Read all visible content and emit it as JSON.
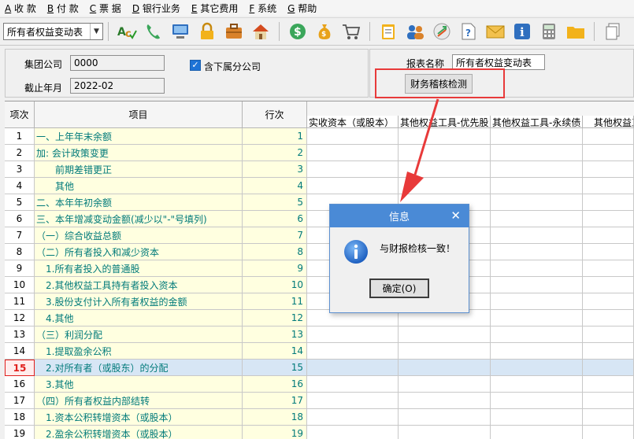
{
  "menu": [
    {
      "key": "A",
      "label": "收 款"
    },
    {
      "key": "B",
      "label": "付 款"
    },
    {
      "key": "C",
      "label": "票 据"
    },
    {
      "key": "D",
      "label": "银行业务"
    },
    {
      "key": "E",
      "label": "其它费用"
    },
    {
      "key": "F",
      "label": "系统"
    },
    {
      "key": "G",
      "label": "帮助"
    }
  ],
  "toolbar": {
    "report_select": "所有者权益变动表"
  },
  "form": {
    "group_label": "集团公司",
    "group_value": "0000",
    "include_sub_label": "含下属分公司",
    "include_sub_checked": true,
    "period_label": "截止年月",
    "period_value": "2022-02",
    "report_name_label": "报表名称",
    "report_name_value": "所有者权益变动表",
    "check_button": "财务稽核检测"
  },
  "grid": {
    "headers": {
      "no": "项次",
      "item": "项目",
      "line": "行次",
      "col1": "实收资本（或股本）",
      "col2": "其他权益工具-优先股",
      "col3": "其他权益工具-永续债",
      "col4": "其他权益工具"
    },
    "rows": [
      {
        "no": "1",
        "item": "一、上年年末余额",
        "line": "1"
      },
      {
        "no": "2",
        "item": "加: 会计政策变更",
        "line": "2"
      },
      {
        "no": "3",
        "item": "　　前期差错更正",
        "line": "3"
      },
      {
        "no": "4",
        "item": "　　其他",
        "line": "4"
      },
      {
        "no": "5",
        "item": "二、本年年初余额",
        "line": "5"
      },
      {
        "no": "6",
        "item": "三、本年增减变动金额(减少以\"-\"号填列)",
        "line": "6"
      },
      {
        "no": "7",
        "item": "（一）综合收益总额",
        "line": "7"
      },
      {
        "no": "8",
        "item": "（二）所有者投入和减少资本",
        "line": "8"
      },
      {
        "no": "9",
        "item": "　1.所有者投入的普通股",
        "line": "9"
      },
      {
        "no": "10",
        "item": "　2.其他权益工具持有者投入资本",
        "line": "10"
      },
      {
        "no": "11",
        "item": "　3.股份支付计入所有者权益的金额",
        "line": "11"
      },
      {
        "no": "12",
        "item": "　4.其他",
        "line": "12"
      },
      {
        "no": "13",
        "item": "（三）利润分配",
        "line": "13"
      },
      {
        "no": "14",
        "item": "　1.提取盈余公积",
        "line": "14"
      },
      {
        "no": "15",
        "item": "　2.对所有者（或股东）的分配",
        "line": "15"
      },
      {
        "no": "16",
        "item": "　3.其他",
        "line": "16"
      },
      {
        "no": "17",
        "item": "（四）所有者权益内部结转",
        "line": "17"
      },
      {
        "no": "18",
        "item": "　1.资本公积转增资本（或股本）",
        "line": "18"
      },
      {
        "no": "19",
        "item": "　2.盈余公积转增资本（或股本）",
        "line": "19"
      }
    ],
    "selected_row": "15"
  },
  "dialog": {
    "title": "信息",
    "message": "与财报检核一致！",
    "ok_label": "确定(O)",
    "icon": "info-icon"
  },
  "colors": {
    "dialog_title": "#4a8ad6",
    "annotation_red": "#e83a3a",
    "item_text": "#007a7a",
    "item_bg": "#ffffe0"
  }
}
